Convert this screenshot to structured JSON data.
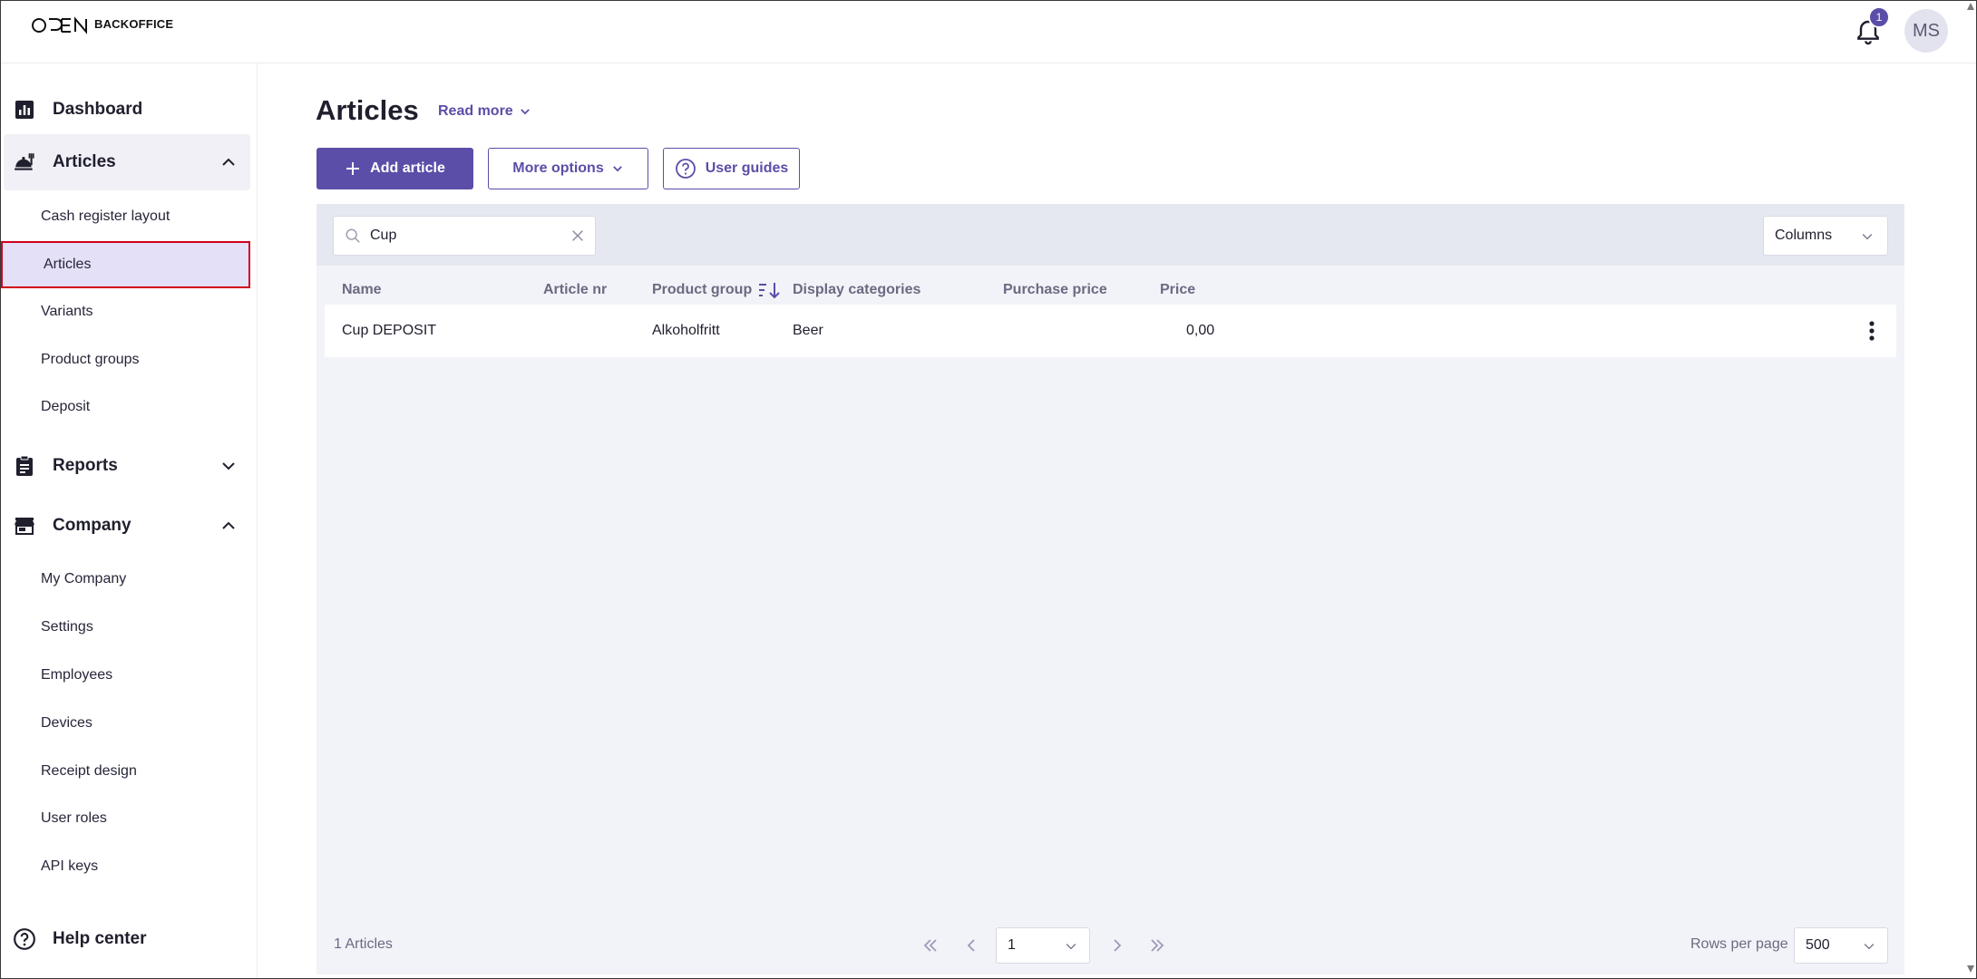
{
  "header": {
    "logo_mark": "OPEN",
    "logo_text": "BACKOFFICE",
    "notification_count": "1",
    "avatar_initials": "MS"
  },
  "sidebar": {
    "dashboard": "Dashboard",
    "articles": "Articles",
    "articles_items": [
      "Cash register layout",
      "Articles",
      "Variants",
      "Product groups",
      "Deposit"
    ],
    "reports": "Reports",
    "company": "Company",
    "company_items": [
      "My Company",
      "Settings",
      "Employees",
      "Devices",
      "Receipt design",
      "User roles",
      "API keys"
    ],
    "help_center": "Help center"
  },
  "main": {
    "title": "Articles",
    "read_more": "Read more",
    "add_article": "Add article",
    "more_options": "More options",
    "user_guides": "User guides",
    "search_value": "Cup",
    "columns": "Columns",
    "table": {
      "headers": [
        "Name",
        "Article nr",
        "Product group",
        "Display categories",
        "Purchase price",
        "Price"
      ],
      "rows": [
        {
          "name": "Cup DEPOSIT",
          "article_nr": "",
          "product_group": "Alkoholfritt",
          "display_categories": "Beer",
          "purchase_price": "",
          "price": "0,00"
        }
      ]
    },
    "footer": {
      "count": "1 Articles",
      "page": "1",
      "rows_per_page_label": "Rows per page",
      "rows_per_page": "500"
    }
  },
  "colors": {
    "accent": "#5b4ea8",
    "selected_bg": "#e4e0f7",
    "highlight_border": "#d0021b"
  }
}
